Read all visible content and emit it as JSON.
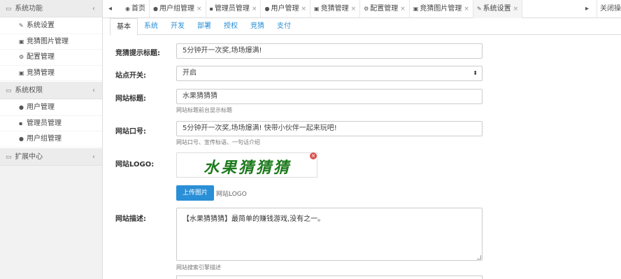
{
  "sidebar": {
    "groups": [
      {
        "label": "系统功能",
        "icon": "folder-icon",
        "items": [
          {
            "label": "系统设置",
            "icon": "wrench-icon"
          },
          {
            "label": "竞猜图片管理",
            "icon": "image-icon"
          },
          {
            "label": "配置管理",
            "icon": "cogs-icon"
          },
          {
            "label": "竞猜管理",
            "icon": "image-icon"
          }
        ]
      },
      {
        "label": "系统权限",
        "icon": "folder-icon",
        "items": [
          {
            "label": "用户管理",
            "icon": "user-icon"
          },
          {
            "label": "管理员管理",
            "icon": "lock-icon"
          },
          {
            "label": "用户组管理",
            "icon": "group-icon"
          }
        ]
      },
      {
        "label": "扩展中心",
        "icon": "folder-icon",
        "items": []
      }
    ]
  },
  "tabs": [
    {
      "label": "首页",
      "icon": "dashboard-icon",
      "closable": false
    },
    {
      "label": "用户组管理",
      "icon": "group-icon",
      "closable": true
    },
    {
      "label": "管理员管理",
      "icon": "lock-icon",
      "closable": true
    },
    {
      "label": "用户管理",
      "icon": "user-icon",
      "closable": true
    },
    {
      "label": "竞猜管理",
      "icon": "image-icon",
      "closable": true
    },
    {
      "label": "配置管理",
      "icon": "cogs-icon",
      "closable": true
    },
    {
      "label": "竞猜图片管理",
      "icon": "image-icon",
      "closable": true
    },
    {
      "label": "系统设置",
      "icon": "wrench-icon",
      "closable": true
    }
  ],
  "tab_close_ops": "关闭操作",
  "subtabs": [
    "基本",
    "系统",
    "开发",
    "部署",
    "授权",
    "竞猜",
    "支付"
  ],
  "form": {
    "tip_title": {
      "label": "竞猜提示标题:",
      "value": "5分钟开一次奖,场场爆满!"
    },
    "site_switch": {
      "label": "站点开关:",
      "value": "开启"
    },
    "site_title": {
      "label": "网站标题:",
      "value": "水果猜猜猜",
      "help": "网站标题前台显示标题"
    },
    "site_slogan": {
      "label": "网站口号:",
      "value": "5分钟开一次奖,场场爆满! 快带小伙伴一起来玩吧!",
      "help": "网站口号、宣传标语、一句话介绍"
    },
    "site_logo": {
      "label": "网站LOGO:",
      "logo_text": "水果猜猜猜",
      "upload_label": "上传图片",
      "upload_hint": "网站LOGO"
    },
    "site_desc": {
      "label": "网站描述:",
      "value": "【水果猜猜猜】最简单的赚钱游戏,没有之一。",
      "help": "网站搜索引擎描述"
    }
  }
}
